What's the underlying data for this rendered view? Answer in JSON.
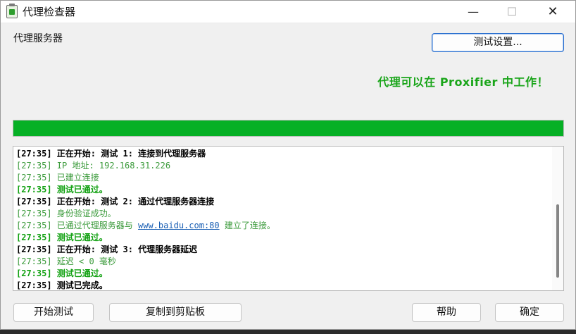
{
  "window": {
    "title": "代理检查器",
    "minimize": "—",
    "maximize": "☐",
    "close": "✕"
  },
  "group_label": "代理服务器",
  "buttons": {
    "test_settings": "测试设置...",
    "start_test": "开始测试",
    "copy_clipboard": "复制到剪贴板",
    "help": "帮助",
    "ok": "确定"
  },
  "status": {
    "message": "代理可以在 Proxifier 中工作！",
    "color": "#1aa51a"
  },
  "progress": {
    "fraction": 1.0,
    "color": "#06b025"
  },
  "log": {
    "lines": [
      {
        "text": "[27:35] 正在开始: 测试 1: 连接到代理服务器",
        "style": "black-bold"
      },
      {
        "text": "[27:35] IP 地址: 192.168.31.226",
        "style": "green"
      },
      {
        "text": "[27:35] 已建立连接",
        "style": "green"
      },
      {
        "text": "[27:35] 测试已通过。",
        "style": "green-bold"
      },
      {
        "text": "[27:35] 正在开始: 测试 2: 通过代理服务器连接",
        "style": "black-bold"
      },
      {
        "text": "[27:35] 身份验证成功。",
        "style": "green"
      },
      {
        "text": "[27:35] 已通过代理服务器与 ",
        "link": "www.baidu.com:80",
        "after": " 建立了连接。",
        "style": "green"
      },
      {
        "text": "[27:35] 测试已通过。",
        "style": "green-bold"
      },
      {
        "text": "[27:35] 正在开始: 测试 3: 代理服务器延迟",
        "style": "black-bold"
      },
      {
        "text": "[27:35] 延迟 < 0 毫秒",
        "style": "green"
      },
      {
        "text": "[27:35] 测试已通过。",
        "style": "green-bold"
      },
      {
        "text": "[27:35] 测试已完成。",
        "style": "black-bold"
      }
    ]
  }
}
